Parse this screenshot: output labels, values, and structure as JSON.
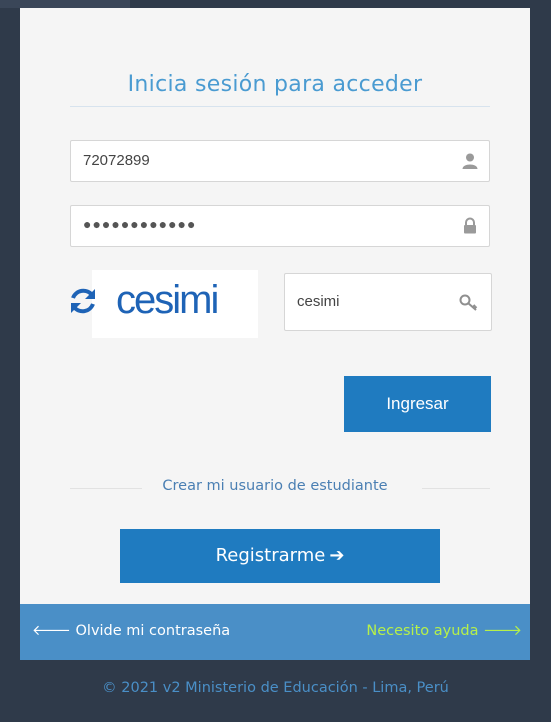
{
  "login": {
    "title": "Inicia sesión para acceder",
    "username_value": "72072899",
    "password_mask": "●●●●●●●●●●●●",
    "captcha_image_text": "cesimi",
    "captcha_input_value": "cesimi",
    "login_button": "Ingresar",
    "create_user_link": "Crear mi usuario de estudiante",
    "register_button": "Registrarme",
    "register_arrow": "➔"
  },
  "links": {
    "forgot_password": "Olvide mi contraseña",
    "need_help": "Necesito ayuda",
    "left_arrow": "🡐",
    "right_arrow": "🡒"
  },
  "footer": {
    "text": "© 2021 v2 Ministerio de Educación - Lima, Perú"
  },
  "colors": {
    "accent": "#1f7bc0",
    "help_bar": "#4a8fc7",
    "help_link": "#b6f04a",
    "background": "#2f3a4a"
  },
  "icons": [
    "user-icon",
    "lock-icon",
    "refresh-icon",
    "key-icon",
    "arrow-right-icon",
    "arrow-left-icon"
  ]
}
